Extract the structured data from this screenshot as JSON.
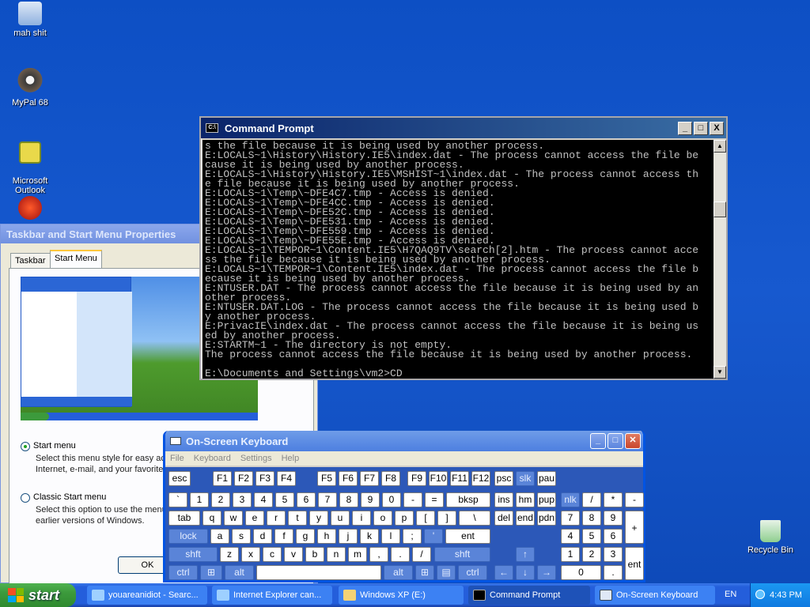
{
  "desktop": {
    "icons": [
      {
        "label": "mah shit",
        "icon": "computer-icon"
      },
      {
        "label": "MyPal 68",
        "icon": "raccoon-browser-icon"
      },
      {
        "label": "Microsoft\nOutlook",
        "icon": "outlook-icon"
      },
      {
        "label": "",
        "icon": "red-app-icon"
      },
      {
        "label": "Recycle Bin",
        "icon": "recycle-bin-icon"
      }
    ]
  },
  "cmd": {
    "title": "Command Prompt",
    "lines": [
      "s the file because it is being used by another process.",
      "E:LOCALS~1\\History\\History.IE5\\index.dat - The process cannot access the file be",
      "cause it is being used by another process.",
      "E:LOCALS~1\\History\\History.IE5\\MSHIST~1\\index.dat - The process cannot access th",
      "e file because it is being used by another process.",
      "E:LOCALS~1\\Temp\\~DFE4C7.tmp - Access is denied.",
      "E:LOCALS~1\\Temp\\~DFE4CC.tmp - Access is denied.",
      "E:LOCALS~1\\Temp\\~DFE52C.tmp - Access is denied.",
      "E:LOCALS~1\\Temp\\~DFE531.tmp - Access is denied.",
      "E:LOCALS~1\\Temp\\~DFE559.tmp - Access is denied.",
      "E:LOCALS~1\\Temp\\~DFE55E.tmp - Access is denied.",
      "E:LOCALS~1\\TEMPOR~1\\Content.IE5\\H7QAQ9TV\\search[2].htm - The process cannot acce",
      "ss the file because it is being used by another process.",
      "E:LOCALS~1\\TEMPOR~1\\Content.IE5\\index.dat - The process cannot access the file b",
      "ecause it is being used by another process.",
      "E:NTUSER.DAT - The process cannot access the file because it is being used by an",
      "other process.",
      "E:NTUSER.DAT.LOG - The process cannot access the file because it is being used b",
      "y another process.",
      "E:PrivacIE\\index.dat - The process cannot access the file because it is being us",
      "ed by another process.",
      "E:STARTM~1 - The directory is not empty.",
      "The process cannot access the file because it is being used by another process.",
      "",
      "E:\\Documents and Settings\\vm2>CD"
    ],
    "buttons": {
      "min": "_",
      "max": "□",
      "close": "X"
    }
  },
  "props": {
    "title": "Taskbar and Start Menu Properties",
    "tabs": [
      "Taskbar",
      "Start Menu"
    ],
    "option1": {
      "label": "Start menu",
      "desc1": "Select this menu style for easy acc",
      "desc2": "Internet, e-mail, and your favorite p"
    },
    "option2": {
      "label": "Classic Start menu",
      "desc1": "Select this option to use the menu",
      "desc2": "earlier versions of Windows."
    },
    "ok": "OK",
    "preview_start": "start"
  },
  "osk": {
    "title": "On-Screen Keyboard",
    "menu": [
      "File",
      "Keyboard",
      "Settings",
      "Help"
    ]
  },
  "taskbar": {
    "start": "start",
    "buttons": [
      {
        "label": "youareanidiot - Searc...",
        "icon": "ie-icon",
        "color": "#3c81f3"
      },
      {
        "label": "Internet Explorer can...",
        "icon": "ie-icon",
        "color": "#3c81f3"
      },
      {
        "label": "Windows XP (E:)",
        "icon": "folder-icon",
        "color": "#3c81f3"
      },
      {
        "label": "Command Prompt",
        "icon": "cmd-icon",
        "color": "#1e52b8"
      },
      {
        "label": "On-Screen Keyboard",
        "icon": "keyboard-icon",
        "color": "#3c81f3"
      }
    ],
    "lang": "EN",
    "time": "4:43 PM"
  }
}
